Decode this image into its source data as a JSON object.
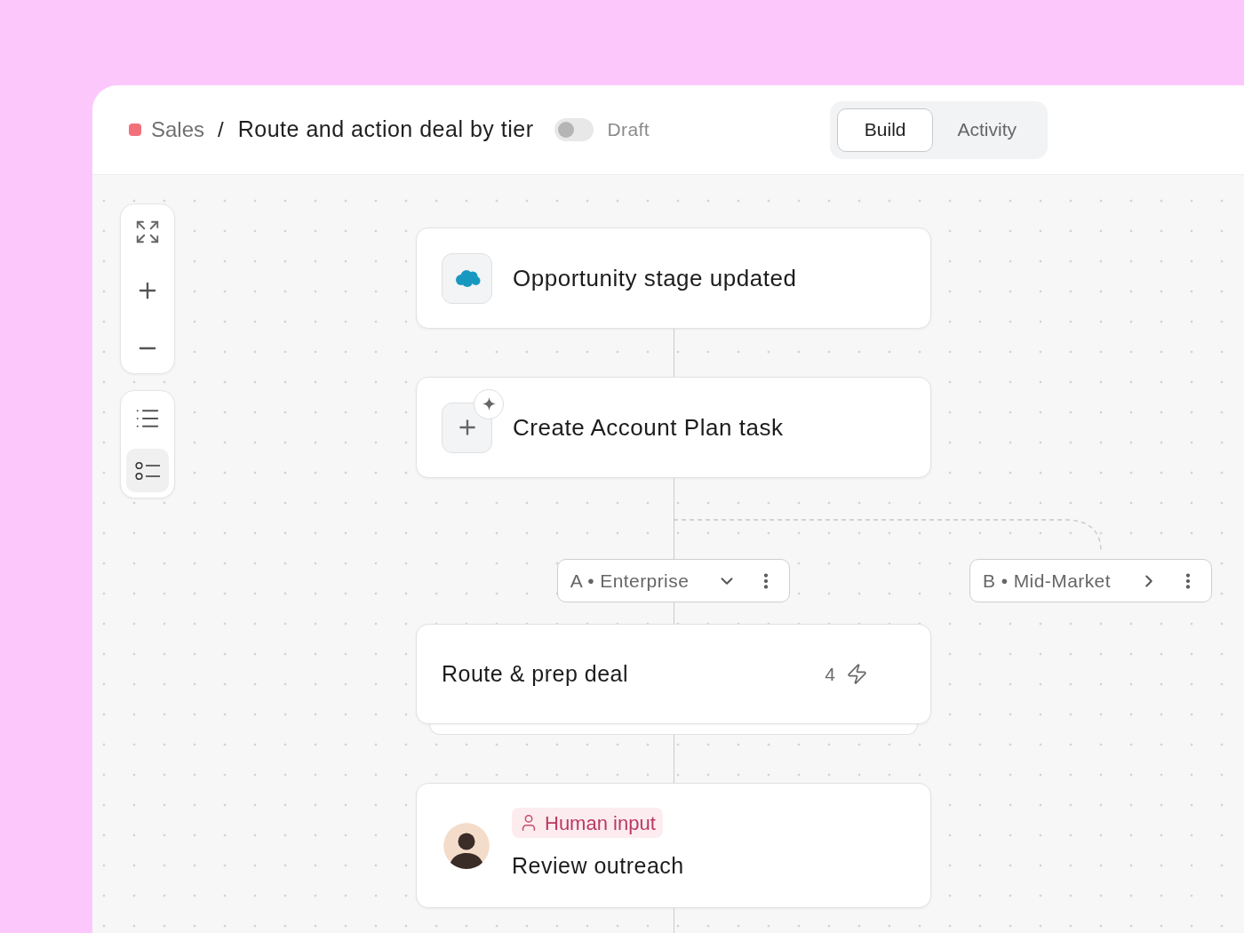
{
  "breadcrumb": {
    "section": {
      "label": "Sales",
      "color": "#f2707a"
    },
    "separator": "/",
    "title": "Route and action deal by tier"
  },
  "publish_toggle": {
    "on": false,
    "label": "Draft"
  },
  "tabs": [
    {
      "label": "Build",
      "selected": true
    },
    {
      "label": "Activity",
      "selected": false
    }
  ],
  "view_modes": [
    {
      "kind": "bullets",
      "selected": false
    },
    {
      "kind": "circles",
      "selected": true
    }
  ],
  "flow": [
    {
      "kind": "trigger",
      "title": "Opportunity stage updated"
    },
    {
      "kind": "action",
      "title": "Create Account Plan task",
      "ai_assisted": true
    },
    {
      "kind": "branches",
      "branches": [
        {
          "label": "A • Enterprise",
          "expanded": true
        },
        {
          "label": "B • Mid-Market",
          "expanded": false
        }
      ]
    },
    {
      "kind": "group",
      "title": "Route & prep deal",
      "count": "4"
    },
    {
      "kind": "human",
      "badge": "Human input",
      "title": "Review outreach"
    }
  ]
}
